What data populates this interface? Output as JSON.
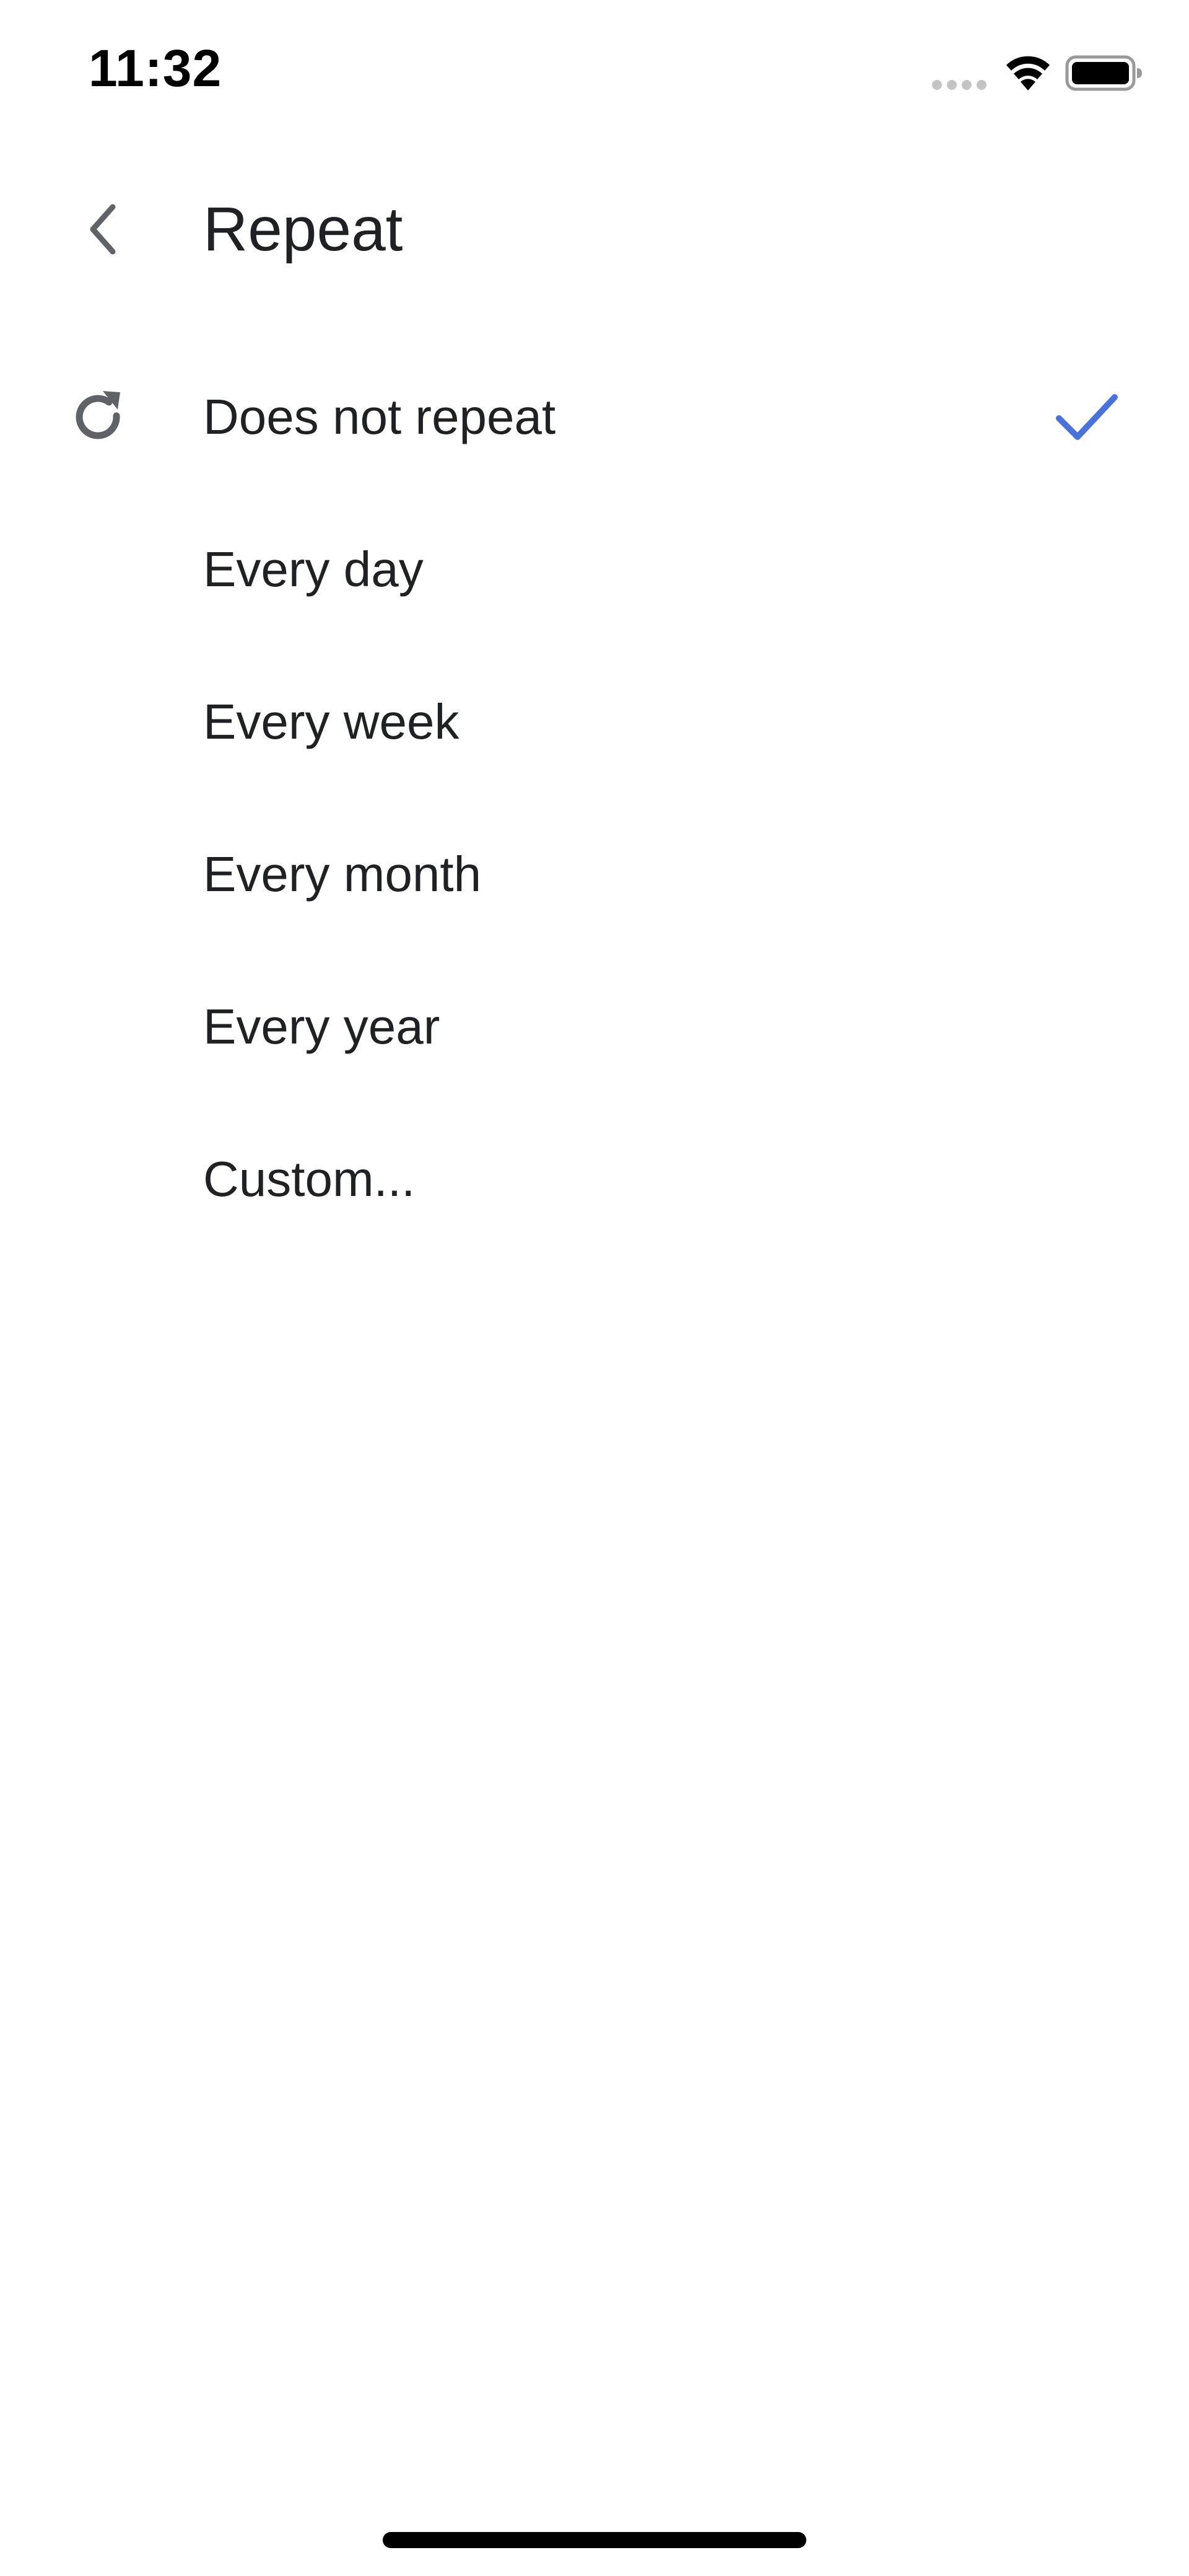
{
  "status_bar": {
    "time": "11:32",
    "icons": [
      "cellular-signal-icon",
      "wifi-icon",
      "battery-icon"
    ]
  },
  "header": {
    "back_icon": "chevron-left-icon",
    "title": "Repeat"
  },
  "options": [
    {
      "label": "Does not repeat",
      "selected": true,
      "leading_icon": "repeat-icon"
    },
    {
      "label": "Every day",
      "selected": false
    },
    {
      "label": "Every week",
      "selected": false
    },
    {
      "label": "Every month",
      "selected": false
    },
    {
      "label": "Every year",
      "selected": false
    },
    {
      "label": "Custom...",
      "selected": false
    }
  ],
  "colors": {
    "accent": "#4a72d9",
    "text_primary": "#202124",
    "icon_gray": "#5f6368",
    "background": "#ffffff"
  }
}
